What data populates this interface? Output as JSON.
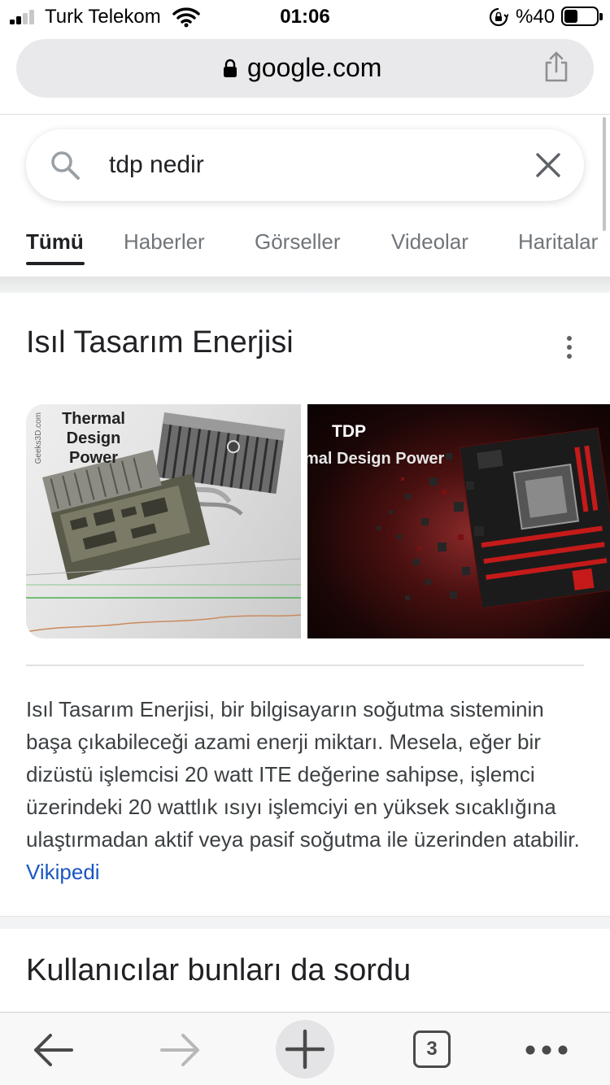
{
  "status_bar": {
    "carrier": "Turk Telekom",
    "time": "01:06",
    "battery_percent": "%40",
    "battery_level": 0.4,
    "signal_bars_active": 2,
    "signal_bars_total": 4
  },
  "url_bar": {
    "domain": "google.com"
  },
  "search": {
    "query": "tdp nedir"
  },
  "tabs": [
    {
      "label": "Tümü",
      "active": true
    },
    {
      "label": "Haberler",
      "active": false
    },
    {
      "label": "Görseller",
      "active": false
    },
    {
      "label": "Videolar",
      "active": false
    },
    {
      "label": "Haritalar",
      "active": false
    }
  ],
  "knowledge_card": {
    "title": "Isıl Tasarım Enerjisi",
    "images": [
      {
        "caption_lines": [
          "Thermal",
          "Design",
          "Power"
        ],
        "side_text": "Geeks3D.com"
      },
      {
        "caption_top": "TDP",
        "caption_bottom": "mal Design Power"
      }
    ],
    "description": "Isıl Tasarım Enerjisi, bir bilgisayarın soğutma sisteminin başa çıkabileceği azami enerji miktarı. Mesela, eğer bir dizüstü işlemcisi 20 watt ITE değerine sahipse, işlemci üzerindeki 20 wattlık ısıyı işlemciyi en yüksek sıcaklığına ulaştırmadan aktif veya pasif soğutma ile üzerinden atabilir.",
    "source_link": "Vikipedi"
  },
  "people_also_ask": {
    "title": "Kullanıcılar bunları da sordu"
  },
  "toolbar": {
    "tab_count": "3"
  },
  "colors": {
    "link": "#1a56c2",
    "text": "#202124",
    "secondary": "#70757a"
  }
}
